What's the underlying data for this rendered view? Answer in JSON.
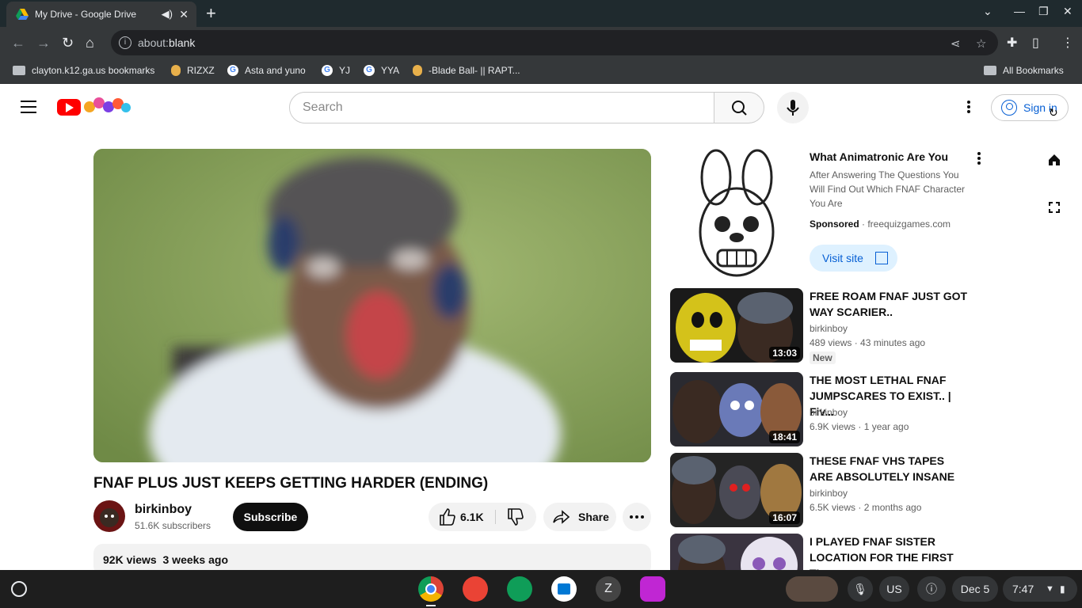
{
  "browser": {
    "tab_title": "My Drive - Google Drive",
    "url_prefix": "about:",
    "url_rest": "blank",
    "bookmarks": [
      {
        "label": "clayton.k12.ga.us bookmarks",
        "icon": "folder-icon"
      },
      {
        "label": "RIZXZ",
        "icon": "coin-icon"
      },
      {
        "label": "Asta and yuno",
        "icon": "google-icon"
      },
      {
        "label": "YJ",
        "icon": "google-icon"
      },
      {
        "label": "YYA",
        "icon": "google-icon"
      },
      {
        "label": "-Blade Ball- || RAPT...",
        "icon": "coin-icon"
      }
    ],
    "all_bookmarks": "All Bookmarks"
  },
  "youtube": {
    "search_placeholder": "Search",
    "sign_in": "Sign in",
    "video": {
      "title": "FNAF PLUS JUST KEEPS GETTING HARDER (ENDING)",
      "channel": "birkinboy",
      "subscribers": "51.6K subscribers",
      "subscribe_label": "Subscribe",
      "likes": "6.1K",
      "share_label": "Share",
      "views": "92K views",
      "age": "3 weeks ago"
    },
    "ad": {
      "title": "What Animatronic Are You",
      "description": "After Answering The Questions You Will Find Out Which FNAF Character You Are",
      "sponsored": "Sponsored",
      "domain": "freequizgames.com",
      "visit_label": "Visit site"
    },
    "recommendations": [
      {
        "title": "FREE ROAM FNAF JUST GOT WAY SCARIER..",
        "channel": "birkinboy",
        "meta": "489 views · 43 minutes ago",
        "badge": "New",
        "duration": "13:03"
      },
      {
        "title": "THE MOST LETHAL FNAF JUMPSCARES TO EXIST.. | Fiv...",
        "channel": "birkinboy",
        "meta": "6.9K views · 1 year ago",
        "badge": "",
        "duration": "18:41"
      },
      {
        "title": "THESE FNAF VHS TAPES ARE ABSOLUTELY INSANE",
        "channel": "birkinboy",
        "meta": "6.5K views · 2 months ago",
        "badge": "",
        "duration": "16:07"
      },
      {
        "title": "I PLAYED FNAF SISTER LOCATION FOR THE FIRST TI...",
        "channel": "",
        "meta": "",
        "badge": "",
        "duration": ""
      }
    ]
  },
  "shelf": {
    "ime": "US",
    "date": "Dec 5",
    "time": "7:47"
  },
  "colors": {
    "youtube_red": "#ff0000",
    "link_blue": "#065fd4",
    "chrome_dark": "#35383a"
  }
}
